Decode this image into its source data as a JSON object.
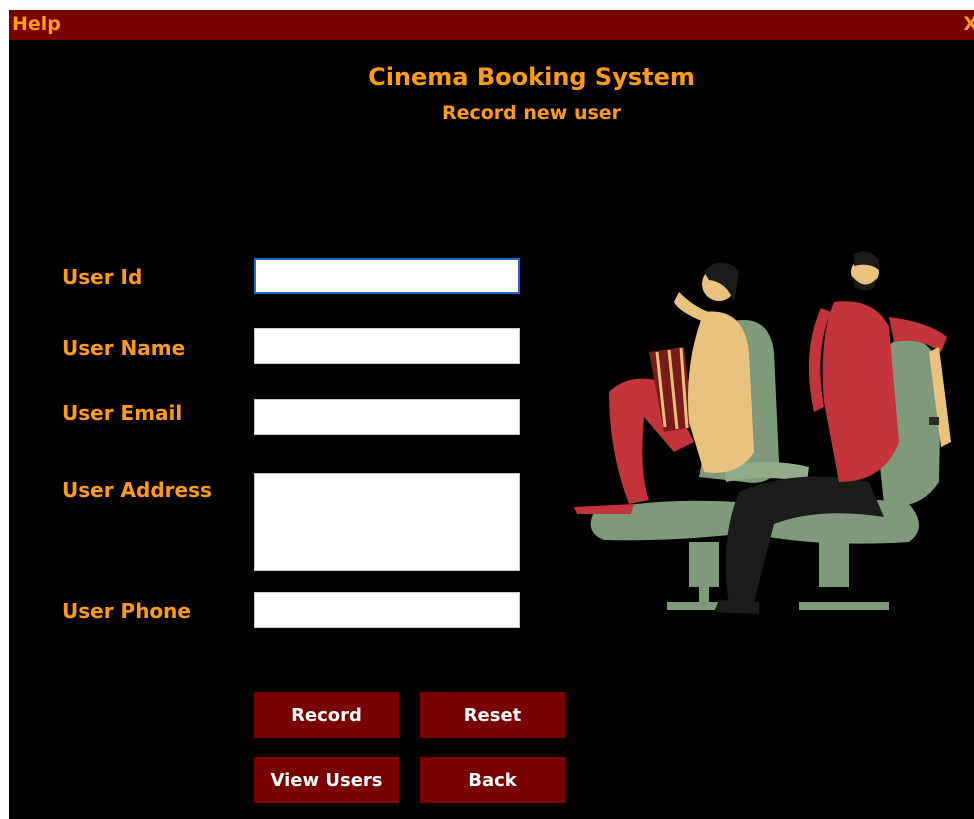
{
  "menubar": {
    "help_label": "Help",
    "close_label": "X"
  },
  "header": {
    "app_title": "Cinema Booking System",
    "form_title": "Record new user"
  },
  "form": {
    "user_id": {
      "label": "User Id",
      "value": ""
    },
    "user_name": {
      "label": "User Name",
      "value": ""
    },
    "user_email": {
      "label": "User Email",
      "value": ""
    },
    "user_address": {
      "label": "User Address",
      "value": ""
    },
    "user_phone": {
      "label": "User Phone",
      "value": ""
    }
  },
  "buttons": {
    "record": "Record",
    "reset": "Reset",
    "view_users": "View Users",
    "back": "Back"
  },
  "colors": {
    "background": "#000000",
    "accent": "#ff9a1a",
    "bar": "#7a0000",
    "button": "#7a0000"
  },
  "illustration": {
    "icon": "cinema-couple-illustration"
  }
}
